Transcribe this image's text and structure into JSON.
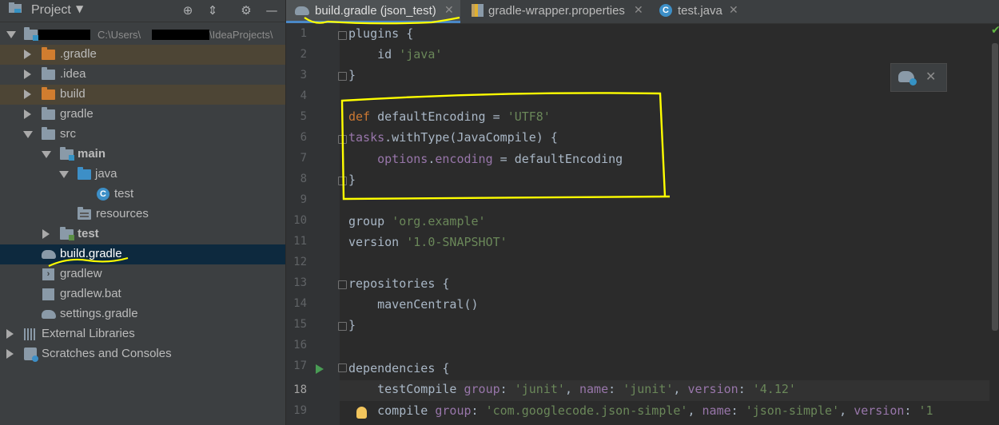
{
  "project_panel": {
    "title": "Project",
    "root": {
      "path": "C:\\Users\\",
      "path_tail": "\\IdeaProjects\\"
    },
    "items": [
      {
        "label": ".gradle"
      },
      {
        "label": ".idea"
      },
      {
        "label": "build"
      },
      {
        "label": "gradle"
      },
      {
        "label": "src"
      },
      {
        "label": "main"
      },
      {
        "label": "java"
      },
      {
        "label": "test"
      },
      {
        "label": "resources"
      },
      {
        "label": "test"
      },
      {
        "label": "build.gradle"
      },
      {
        "label": "gradlew"
      },
      {
        "label": "gradlew.bat"
      },
      {
        "label": "settings.gradle"
      },
      {
        "label": "External Libraries"
      },
      {
        "label": "Scratches and Consoles"
      }
    ]
  },
  "tabs": [
    {
      "label": "build.gradle (json_test)",
      "icon": "gradle-icon",
      "active": true
    },
    {
      "label": "gradle-wrapper.properties",
      "icon": "properties-icon",
      "active": false
    },
    {
      "label": "test.java",
      "icon": "java-class-icon",
      "active": false
    }
  ],
  "editor": {
    "line_numbers": [
      "1",
      "2",
      "3",
      "4",
      "5",
      "6",
      "7",
      "8",
      "9",
      "10",
      "11",
      "12",
      "13",
      "14",
      "15",
      "16",
      "17",
      "18",
      "19"
    ],
    "current_line": "18",
    "code": {
      "l1_a": "plugins {",
      "l2_a": "    id ",
      "l2_b": "'java'",
      "l3_a": "}",
      "l5_a": "def",
      "l5_b": " defaultEncoding = ",
      "l5_c": "'UTF8'",
      "l6_a": "tasks",
      "l6_b": ".withType(JavaCompile) {",
      "l7_a": "options",
      "l7_b": ".",
      "l7_c": "encoding",
      "l7_d": " = defaultEncoding",
      "l8_a": "}",
      "l10_a": "group ",
      "l10_b": "'org.example'",
      "l11_a": "version ",
      "l11_b": "'1.0-SNAPSHOT'",
      "l13_a": "repositories {",
      "l14_a": "    mavenCentral()",
      "l15_a": "}",
      "l17_a": "dependencies {",
      "l18_a": "    testCompile ",
      "l18_b": "group",
      "l18_c": ": ",
      "l18_d": "'junit'",
      "l18_e": ", ",
      "l18_f": "name",
      "l18_g": ": ",
      "l18_h": "'junit'",
      "l18_i": ", ",
      "l18_j": "version",
      "l18_k": ": ",
      "l18_l": "'4.12'",
      "l19_a": "    compile ",
      "l19_b": "group",
      "l19_c": ": ",
      "l19_d": "'com.googlecode.json-simple'",
      "l19_e": ", ",
      "l19_f": "name",
      "l19_g": ": ",
      "l19_h": "'json-simple'",
      "l19_i": ", ",
      "l19_j": "version",
      "l19_k": ": ",
      "l19_l": "'1"
    }
  },
  "colors": {
    "keyword": "#cc7832",
    "string": "#6a8759",
    "property": "#9876aa",
    "annotation": "#ffff00",
    "selection": "#0d293e"
  }
}
